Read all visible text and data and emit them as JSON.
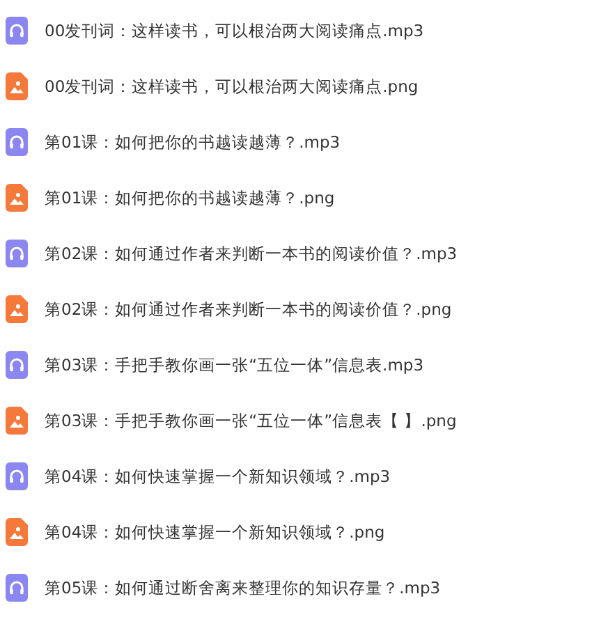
{
  "files": [
    {
      "kind": "audio",
      "name": "00发刊词：这样读书，可以根治两大阅读痛点.mp3"
    },
    {
      "kind": "image",
      "name": "00发刊词：这样读书，可以根治两大阅读痛点.png"
    },
    {
      "kind": "audio",
      "name": "第01课：如何把你的书越读越薄？.mp3"
    },
    {
      "kind": "image",
      "name": "第01课：如何把你的书越读越薄？.png"
    },
    {
      "kind": "audio",
      "name": "第02课：如何通过作者来判断一本书的阅读价值？.mp3"
    },
    {
      "kind": "image",
      "name": "第02课：如何通过作者来判断一本书的阅读价值？.png"
    },
    {
      "kind": "audio",
      "name": "第03课：手把手教你画一张“五位一体”信息表.mp3"
    },
    {
      "kind": "image",
      "name": "第03课：手把手教你画一张“五位一体”信息表【 】.png"
    },
    {
      "kind": "audio",
      "name": "第04课：如何快速掌握一个新知识领域？.mp3"
    },
    {
      "kind": "image",
      "name": "第04课：如何快速掌握一个新知识领域？.png"
    },
    {
      "kind": "audio",
      "name": "第05课：如何通过断舍离来整理你的知识存量？.mp3"
    }
  ]
}
